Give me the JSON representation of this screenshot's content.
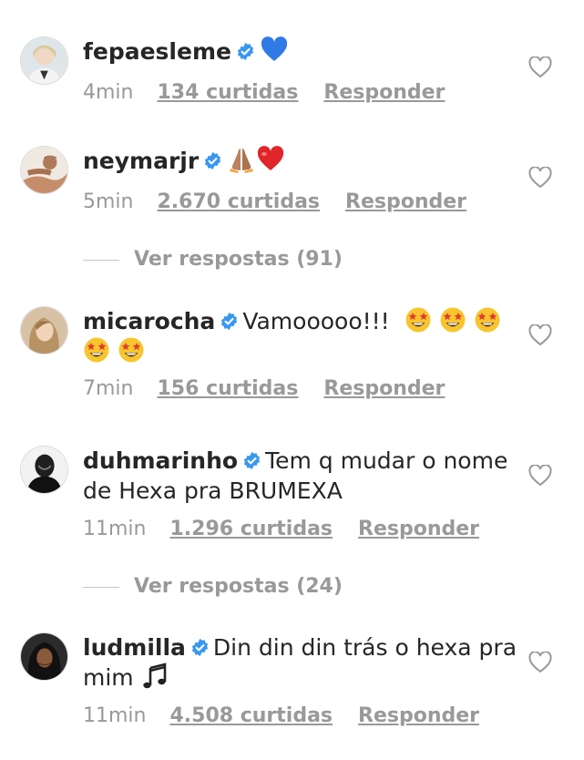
{
  "comments": [
    {
      "username": "fepaesleme",
      "verified": true,
      "text": "",
      "emojis": [
        "blue-heart"
      ],
      "time": "4min",
      "likes": "134 curtidas",
      "reply": "Responder"
    },
    {
      "username": "neymarjr",
      "verified": true,
      "text": "",
      "emojis": [
        "folded-hands",
        "red-heart"
      ],
      "time": "5min",
      "likes": "2.670 curtidas",
      "reply": "Responder"
    },
    {
      "username": "micarocha",
      "verified": true,
      "text": "Vamooooo!!!",
      "emojis": [
        "star-struck",
        "star-struck",
        "star-struck",
        "star-struck",
        "star-struck"
      ],
      "time": "7min",
      "likes": "156 curtidas",
      "reply": "Responder"
    },
    {
      "username": "duhmarinho",
      "verified": true,
      "text": "Tem q mudar o nome de Hexa pra BRUMEXA",
      "emojis": [],
      "time": "11min",
      "likes": "1.296 curtidas",
      "reply": "Responder"
    },
    {
      "username": "ludmilla",
      "verified": true,
      "text": "Din din din trás o hexa pra mim",
      "emojis": [
        "musical-notes"
      ],
      "time": "11min",
      "likes": "4.508 curtidas",
      "reply": "Responder"
    }
  ],
  "view_replies": [
    {
      "label": "Ver respostas (91)"
    },
    {
      "label": "Ver respostas (24)"
    }
  ],
  "colors": {
    "verified": "#3897f0",
    "meta": "#999999",
    "text": "#262626"
  }
}
